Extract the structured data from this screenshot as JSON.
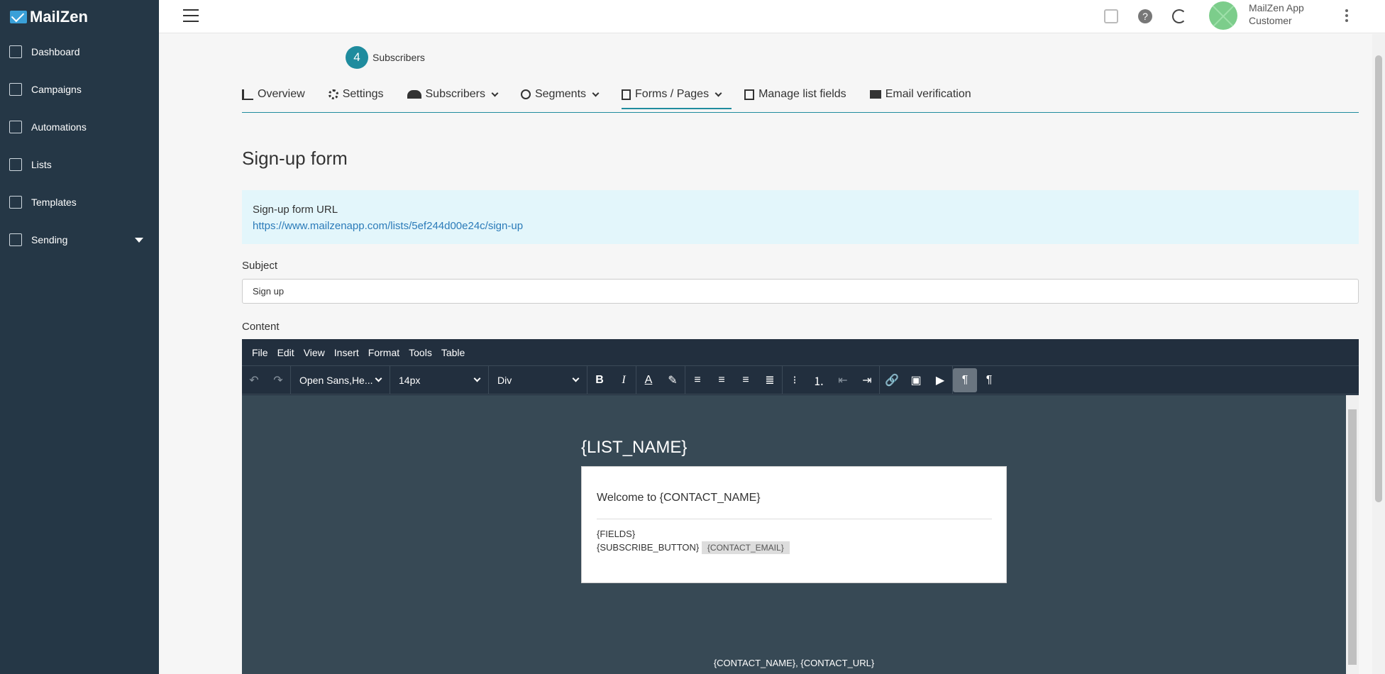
{
  "app": {
    "name": "MailZen"
  },
  "sidebar": {
    "items": [
      {
        "label": "Dashboard",
        "icon": "home-icon"
      },
      {
        "label": "Campaigns",
        "icon": "megaphone-icon"
      },
      {
        "label": "Automations",
        "icon": "automation-icon"
      },
      {
        "label": "Lists",
        "icon": "list-icon"
      },
      {
        "label": "Templates",
        "icon": "template-icon"
      },
      {
        "label": "Sending",
        "icon": "sending-icon"
      }
    ]
  },
  "topbar": {
    "user_name": "MailZen App",
    "user_role": "Customer"
  },
  "subscribers": {
    "count": "4",
    "label": "Subscribers"
  },
  "tabs": [
    {
      "label": "Overview"
    },
    {
      "label": "Settings"
    },
    {
      "label": "Subscribers"
    },
    {
      "label": "Segments"
    },
    {
      "label": "Forms / Pages"
    },
    {
      "label": "Manage list fields"
    },
    {
      "label": "Email verification"
    }
  ],
  "page": {
    "title": "Sign-up form",
    "url_label": "Sign-up form URL",
    "url": "https://www.mailzenapp.com/lists/5ef244d00e24c/sign-up",
    "subject_label": "Subject",
    "subject_value": "Sign up",
    "content_label": "Content"
  },
  "editor": {
    "menu": [
      "File",
      "Edit",
      "View",
      "Insert",
      "Format",
      "Tools",
      "Table"
    ],
    "font_family": "Open Sans,He...",
    "font_size": "14px",
    "block": "Div",
    "content": {
      "list_name": "{LIST_NAME}",
      "welcome": "Welcome to {CONTACT_NAME}",
      "fields": "{FIELDS}",
      "subscribe_button": "{SUBSCRIBE_BUTTON}",
      "contact_email": "{CONTACT_EMAIL}",
      "footer": "{CONTACT_NAME}, {CONTACT_URL}"
    }
  }
}
